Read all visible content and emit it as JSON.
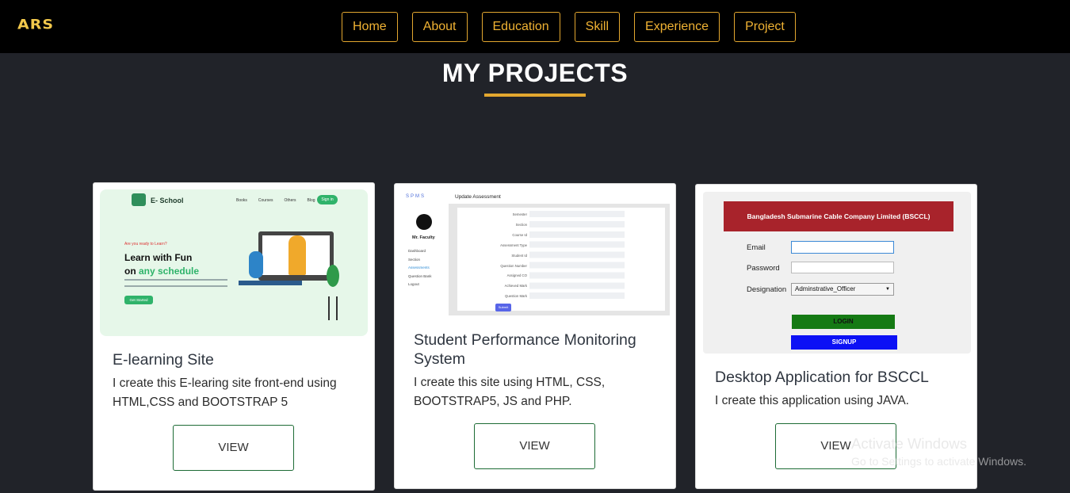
{
  "header": {
    "logo": "ARS",
    "nav": [
      "Home",
      "About",
      "Education",
      "Skill",
      "Experience",
      "Project"
    ]
  },
  "section": {
    "title": "MY PROJECTS"
  },
  "projects": [
    {
      "title": "E-learning Site",
      "description": "I create this E-learing site front-end using HTML,CSS and BOOTSTRAP 5",
      "button": "VIEW",
      "preview": {
        "brand": "E- School",
        "menu": [
          "Books",
          "Courses",
          "Others",
          "Blog"
        ],
        "signup": "Sign in",
        "tagline": "Are you ready to Learn?",
        "headline1": "Learn with Fun",
        "headline2a": "on ",
        "headline2b": "any schedule",
        "get_started": "Get Started"
      }
    },
    {
      "title": "Student Performance Monitoring System",
      "description": "I create this site using HTML, CSS, BOOTSTRAP5, JS and PHP.",
      "button": "VIEW",
      "preview": {
        "brand": "SPMS",
        "user": "Mr. Faculty",
        "menu": [
          "Dashboard",
          "Section",
          "Assessments",
          "Question Bank",
          "Logout"
        ],
        "page_title": "Update Assessment",
        "fields": [
          "Semester",
          "Section",
          "Course Id",
          "Assessment Type",
          "Student Id",
          "Question Number",
          "Assigned CO",
          "Achieved Mark",
          "Question Mark"
        ],
        "submit": "Submit"
      }
    },
    {
      "title": "Desktop Application for BSCCL",
      "description": "I create this application using JAVA.",
      "button": "VIEW",
      "preview": {
        "banner": "Bangladesh Submarine Cable Company Limited (BSCCL)",
        "email_label": "Email",
        "password_label": "Password",
        "designation_label": "Designation",
        "designation_value": "Adminstrative_Officer",
        "login": "LOGIN",
        "signup": "SIGNUP"
      }
    }
  ],
  "watermark": {
    "line1": "Activate Windows",
    "line2": "Go to Settings to activate Windows."
  },
  "colors": {
    "accent": "#e3a72f",
    "background": "#212329",
    "button_border": "#1d6b35"
  }
}
